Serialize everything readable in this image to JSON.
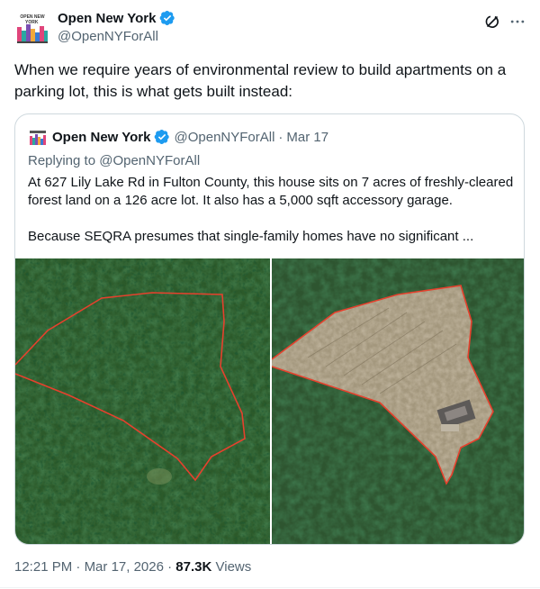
{
  "author": {
    "name": "Open New York",
    "handle": "@OpenNYForAll",
    "avatar_text": "OPEN NEW YORK",
    "avatar_icon": "open-new-york-logo"
  },
  "tweet": {
    "text": "When we require years of environmental review to build apartments on a parking lot, this is what gets built instead:",
    "time": "12:21 PM",
    "date": "Mar 17, 2026",
    "views_count": "87.3K",
    "views_label": "Views"
  },
  "quoted": {
    "name": "Open New York",
    "handle": "@OpenNYForAll",
    "date": "Mar 17",
    "replying_prefix": "Replying to",
    "replying_to": "@OpenNYForAll",
    "text": "At 627 Lily Lake Rd in Fulton County, this house sits on 7 acres of freshly-cleared forest land on a 126 acre lot. It also has a 5,000 sqft accessory garage.",
    "text2": "Because SEQRA presumes that single-family homes have no significant ...",
    "images": [
      "forest-before-image",
      "cleared-lot-after-image"
    ]
  },
  "icons": {
    "verified": "verified-badge-icon",
    "grok": "grok-icon",
    "more": "more-options-icon"
  },
  "colors": {
    "verified_blue": "#1d9bf0",
    "text_primary": "#0f1419",
    "text_secondary": "#536471",
    "border": "#cfd9de",
    "parcel_outline": "#e5412d"
  }
}
